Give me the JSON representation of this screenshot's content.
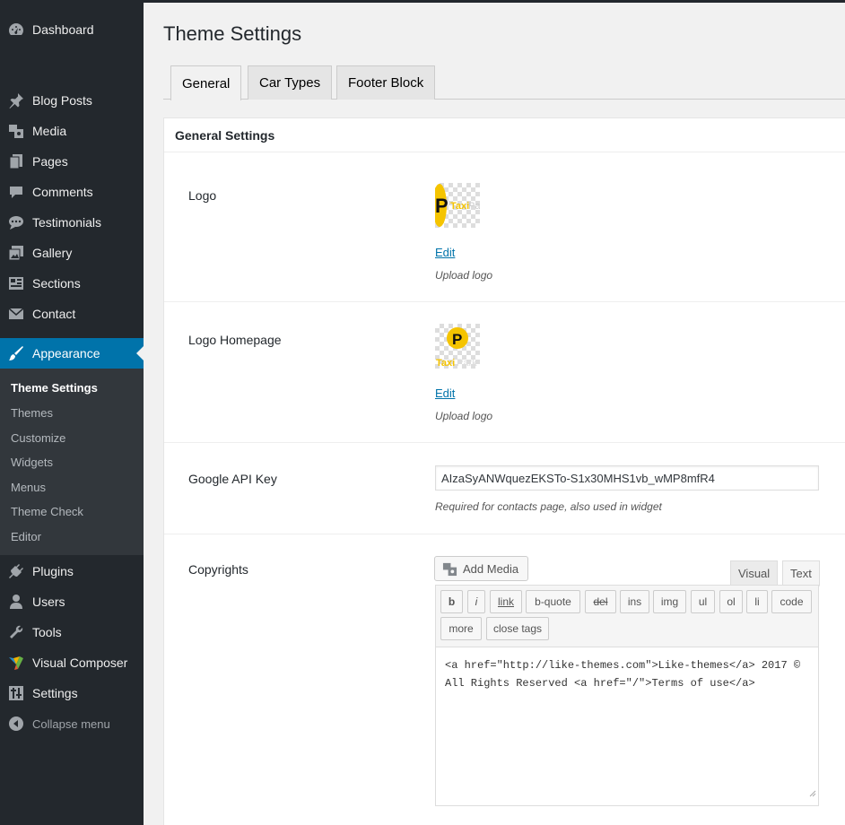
{
  "sidebar": {
    "items": [
      {
        "label": "Dashboard",
        "icon": "dashboard-icon"
      },
      {
        "label": "Blog Posts",
        "icon": "pin-icon"
      },
      {
        "label": "Media",
        "icon": "media-icon"
      },
      {
        "label": "Pages",
        "icon": "pages-icon"
      },
      {
        "label": "Comments",
        "icon": "comment-icon"
      },
      {
        "label": "Testimonials",
        "icon": "testimonials-icon"
      },
      {
        "label": "Gallery",
        "icon": "gallery-icon"
      },
      {
        "label": "Sections",
        "icon": "sections-icon"
      },
      {
        "label": "Contact",
        "icon": "mail-icon"
      },
      {
        "label": "Appearance",
        "icon": "brush-icon"
      },
      {
        "label": "Plugins",
        "icon": "plugin-icon"
      },
      {
        "label": "Users",
        "icon": "user-icon"
      },
      {
        "label": "Tools",
        "icon": "wrench-icon"
      },
      {
        "label": "Visual Composer",
        "icon": "visual-composer-icon"
      },
      {
        "label": "Settings",
        "icon": "settings-icon"
      },
      {
        "label": "Collapse menu",
        "icon": "collapse-icon"
      }
    ],
    "submenu": [
      "Theme Settings",
      "Themes",
      "Customize",
      "Widgets",
      "Menus",
      "Theme Check",
      "Editor"
    ]
  },
  "page": {
    "title": "Theme Settings",
    "tabs": [
      "General",
      "Car Types",
      "Footer Block"
    ],
    "section_title": "General Settings"
  },
  "fields": {
    "logo": {
      "label": "Logo",
      "edit": "Edit",
      "desc": "Upload logo"
    },
    "logo_home": {
      "label": "Logo Homepage",
      "edit": "Edit",
      "desc": "Upload logo"
    },
    "api": {
      "label": "Google API Key",
      "value": "AIzaSyANWquezEKSTo-S1x30MHS1vb_wMP8mfR4",
      "desc": "Required for contacts page, also used in widget"
    },
    "copyrights": {
      "label": "Copyrights",
      "add_media": "Add Media",
      "visual_tab": "Visual",
      "text_tab": "Text",
      "quicktags": [
        "b",
        "i",
        "link",
        "b-quote",
        "del",
        "ins",
        "img",
        "ul",
        "ol",
        "li",
        "code",
        "more",
        "close tags"
      ],
      "content_line1": "<a href=\"http://like-themes.com\">Like-themes</a> 2017 ©",
      "content_line2": "All Rights Reserved <a href=\"/\">Terms of use</a>"
    }
  },
  "colors": {
    "admin_dark": "#23282d",
    "admin_sub": "#32373c",
    "accent": "#0073aa",
    "logo_yellow": "#f5c400"
  }
}
